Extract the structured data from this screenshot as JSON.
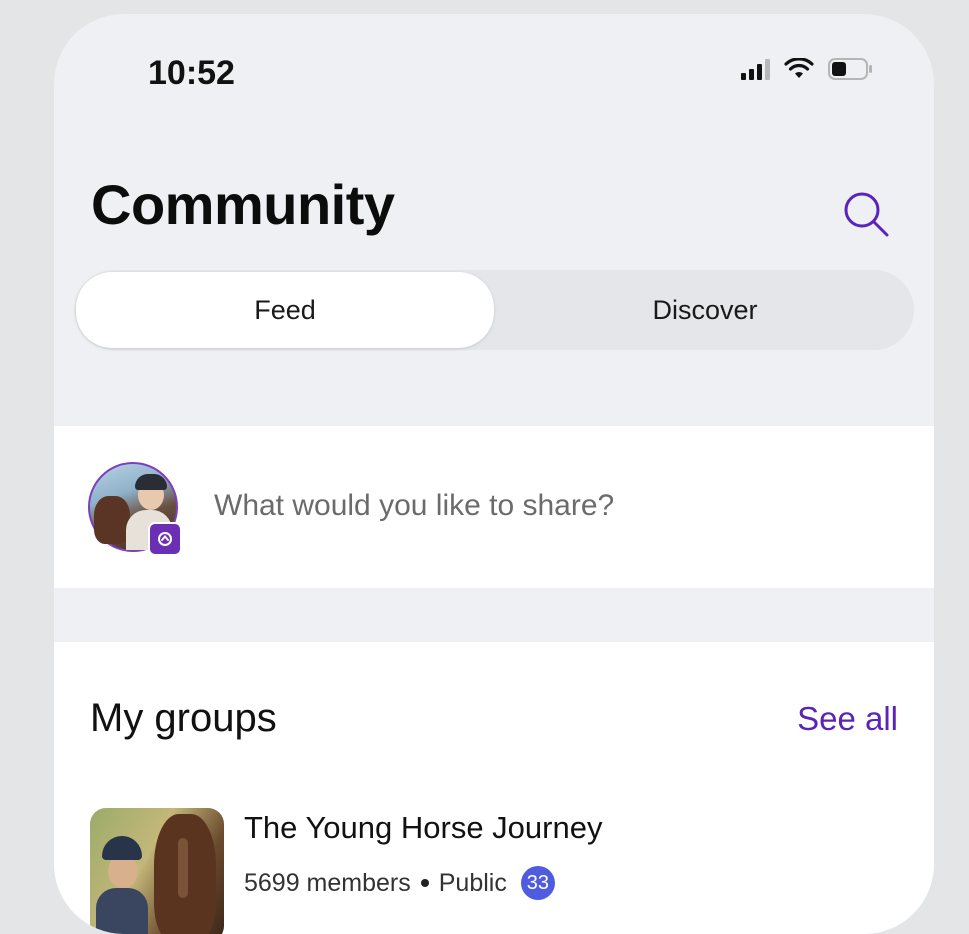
{
  "status_bar": {
    "time": "10:52",
    "icons": [
      "signal-icon",
      "wifi-icon",
      "battery-icon"
    ]
  },
  "header": {
    "title": "Community",
    "search_icon": "search-icon"
  },
  "tabs": [
    {
      "label": "Feed",
      "active": true
    },
    {
      "label": "Discover",
      "active": false
    }
  ],
  "composer": {
    "placeholder": "What would you like to share?",
    "avatar_badge_icon": "share-badge-icon"
  },
  "groups": {
    "title": "My groups",
    "see_all": "See all",
    "items": [
      {
        "name": "The Young Horse Journey",
        "members": "5699 members",
        "privacy": "Public",
        "badge": "33"
      }
    ]
  },
  "colors": {
    "accent": "#5b24b8",
    "badge_blue": "#4f5ce0",
    "background": "#eef0f3"
  }
}
